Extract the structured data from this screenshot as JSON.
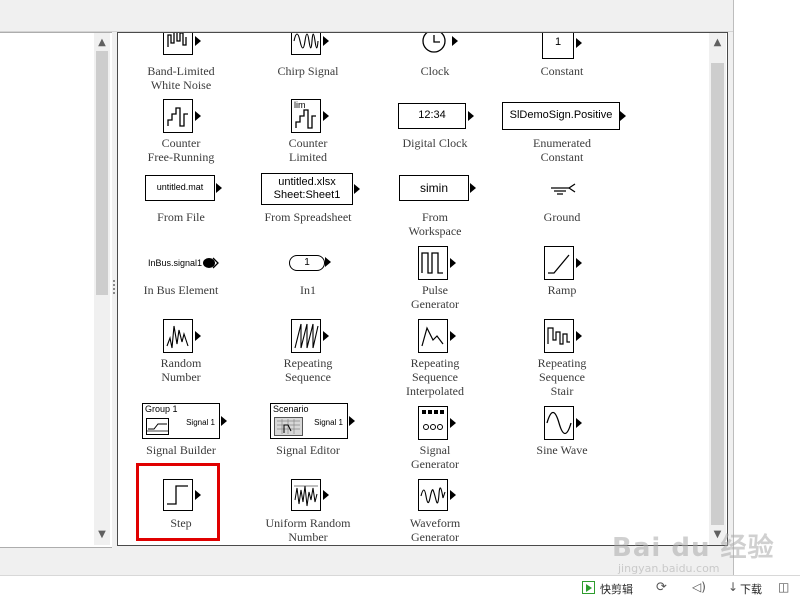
{
  "blocks": {
    "band_limited_white_noise": "Band-Limited\nWhite Noise",
    "chirp_signal": "Chirp Signal",
    "clock": "Clock",
    "constant": "Constant",
    "constant_value": "1",
    "counter_free_running": "Counter\nFree-Running",
    "counter_limited": "Counter\nLimited",
    "counter_limited_icon_text": "lim",
    "digital_clock": "Digital Clock",
    "digital_clock_value": "12:34",
    "enumerated_constant": "Enumerated\nConstant",
    "enumerated_constant_value": "SlDemoSign.Positive",
    "from_file": "From File",
    "from_file_value": "untitled.mat",
    "from_spreadsheet": "From Spreadsheet",
    "from_spreadsheet_value_1": "untitled.xlsx",
    "from_spreadsheet_value_2": "Sheet:Sheet1",
    "from_workspace": "From\nWorkspace",
    "from_workspace_value": "simin",
    "ground": "Ground",
    "in_bus_element": "In Bus Element",
    "in_bus_element_value": "InBus.signal1",
    "in1": "In1",
    "in1_value": "1",
    "pulse_generator": "Pulse\nGenerator",
    "ramp": "Ramp",
    "random_number": "Random\nNumber",
    "repeating_sequence": "Repeating\nSequence",
    "repeating_sequence_interpolated": "Repeating\nSequence\nInterpolated",
    "repeating_sequence_stair": "Repeating\nSequence\nStair",
    "signal_builder": "Signal Builder",
    "signal_builder_group": "Group 1",
    "signal_builder_signal": "Signal 1",
    "signal_editor": "Signal Editor",
    "signal_editor_scenario": "Scenario",
    "signal_editor_signal": "Signal 1",
    "signal_generator": "Signal\nGenerator",
    "sine_wave": "Sine Wave",
    "step": "Step",
    "uniform_random_number": "Uniform Random\nNumber",
    "waveform_generator": "Waveform\nGenerator"
  },
  "taskbar": {
    "item1": "快剪辑",
    "item2": "下载"
  },
  "watermark": {
    "brand": "Bai du 经验",
    "url": "jingyan.baidu.com"
  },
  "colors": {
    "highlight": "#e00000"
  }
}
